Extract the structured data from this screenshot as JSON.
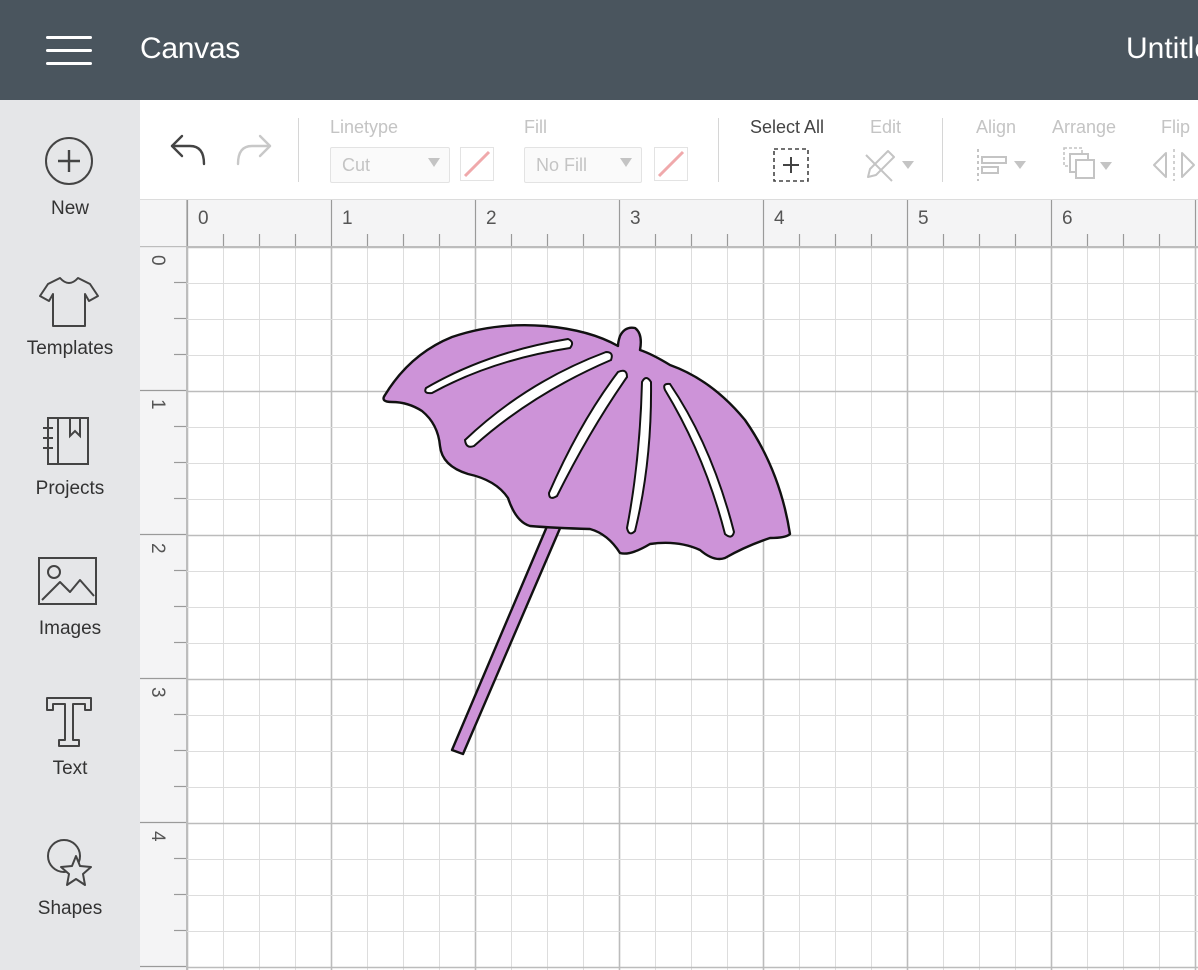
{
  "header": {
    "menu_icon": "hamburger-menu-icon",
    "app_title": "Canvas",
    "project_title": "Untitle"
  },
  "sidebar": {
    "items": [
      {
        "label": "New",
        "icon": "plus-circle-icon"
      },
      {
        "label": "Templates",
        "icon": "tshirt-icon"
      },
      {
        "label": "Projects",
        "icon": "notebook-icon"
      },
      {
        "label": "Images",
        "icon": "image-icon"
      },
      {
        "label": "Text",
        "icon": "text-icon"
      },
      {
        "label": "Shapes",
        "icon": "shapes-icon"
      }
    ]
  },
  "toolbar": {
    "undo_icon": "undo-icon",
    "redo_icon": "redo-icon",
    "linetype": {
      "label": "Linetype",
      "value": "Cut"
    },
    "fill": {
      "label": "Fill",
      "value": "No Fill"
    },
    "select_all": {
      "label": "Select All"
    },
    "edit": {
      "label": "Edit"
    },
    "align": {
      "label": "Align"
    },
    "arrange": {
      "label": "Arrange"
    },
    "flip": {
      "label": "Flip"
    }
  },
  "rulers": {
    "horizontal": [
      "0",
      "1",
      "2",
      "3",
      "4",
      "5",
      "6"
    ],
    "vertical": [
      "0",
      "1",
      "2",
      "3",
      "4"
    ],
    "unit": "in"
  },
  "canvas": {
    "object": "beach-umbrella",
    "fill_color": "#cd93d8",
    "stroke_color": "#111111",
    "grid_color": "#dddddd",
    "grid_major_color": "#bcbcbc"
  }
}
